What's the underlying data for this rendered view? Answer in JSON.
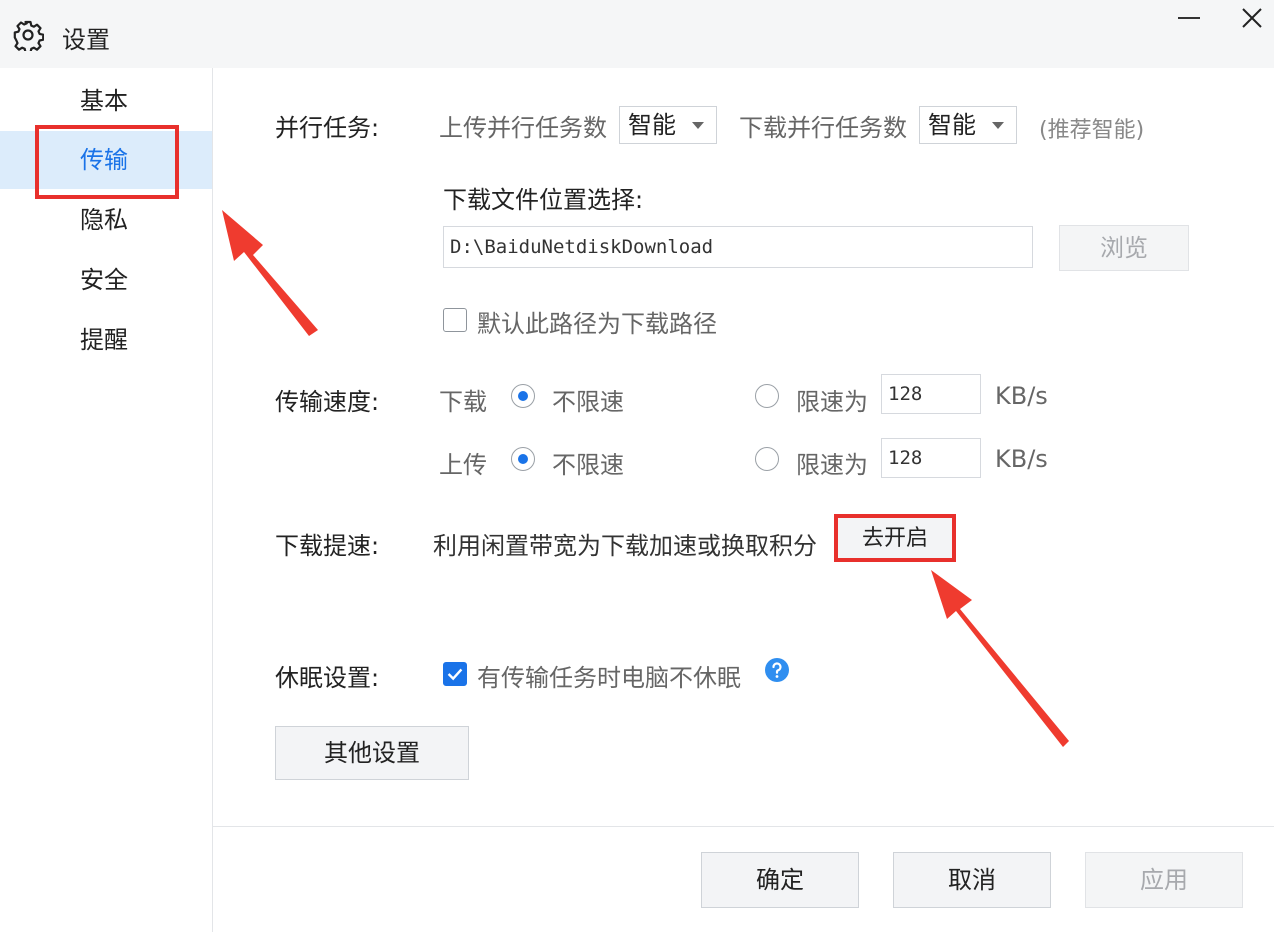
{
  "window": {
    "title": "设置",
    "icons": {
      "settings": "gear-icon",
      "minimize": "minimize-icon",
      "close": "close-icon"
    }
  },
  "sidebar": {
    "items": [
      {
        "label": "基本",
        "active": false
      },
      {
        "label": "传输",
        "active": true
      },
      {
        "label": "隐私",
        "active": false
      },
      {
        "label": "安全",
        "active": false
      },
      {
        "label": "提醒",
        "active": false
      }
    ]
  },
  "parallel": {
    "label": "并行任务:",
    "upload_label": "上传并行任务数",
    "upload_value": "智能",
    "download_label": "下载并行任务数",
    "download_value": "智能",
    "hint": "(推荐智能)"
  },
  "download_location": {
    "label": "下载文件位置选择:",
    "path": "D:\\BaiduNetdiskDownload",
    "browse_label": "浏览",
    "default_checkbox_label": "默认此路径为下载路径",
    "default_checked": false
  },
  "speed": {
    "label": "传输速度:",
    "rows": [
      {
        "direction": "下载",
        "unlimited_label": "不限速",
        "unlimited_selected": true,
        "limit_label": "限速为",
        "limit_value": "128",
        "unit": "KB/s"
      },
      {
        "direction": "上传",
        "unlimited_label": "不限速",
        "unlimited_selected": true,
        "limit_label": "限速为",
        "limit_value": "128",
        "unit": "KB/s"
      }
    ]
  },
  "accelerate": {
    "label": "下载提速:",
    "desc": "利用闲置带宽为下载加速或换取积分",
    "button_label": "去开启"
  },
  "sleep": {
    "label": "休眠设置:",
    "checkbox_label": "有传输任务时电脑不休眠",
    "checked": true
  },
  "other_settings_label": "其他设置",
  "footer": {
    "ok_label": "确定",
    "cancel_label": "取消",
    "apply_label": "应用"
  },
  "colors": {
    "accent": "#1a73e8",
    "highlight": "#e8302c",
    "active_bg": "#dcecfb"
  }
}
